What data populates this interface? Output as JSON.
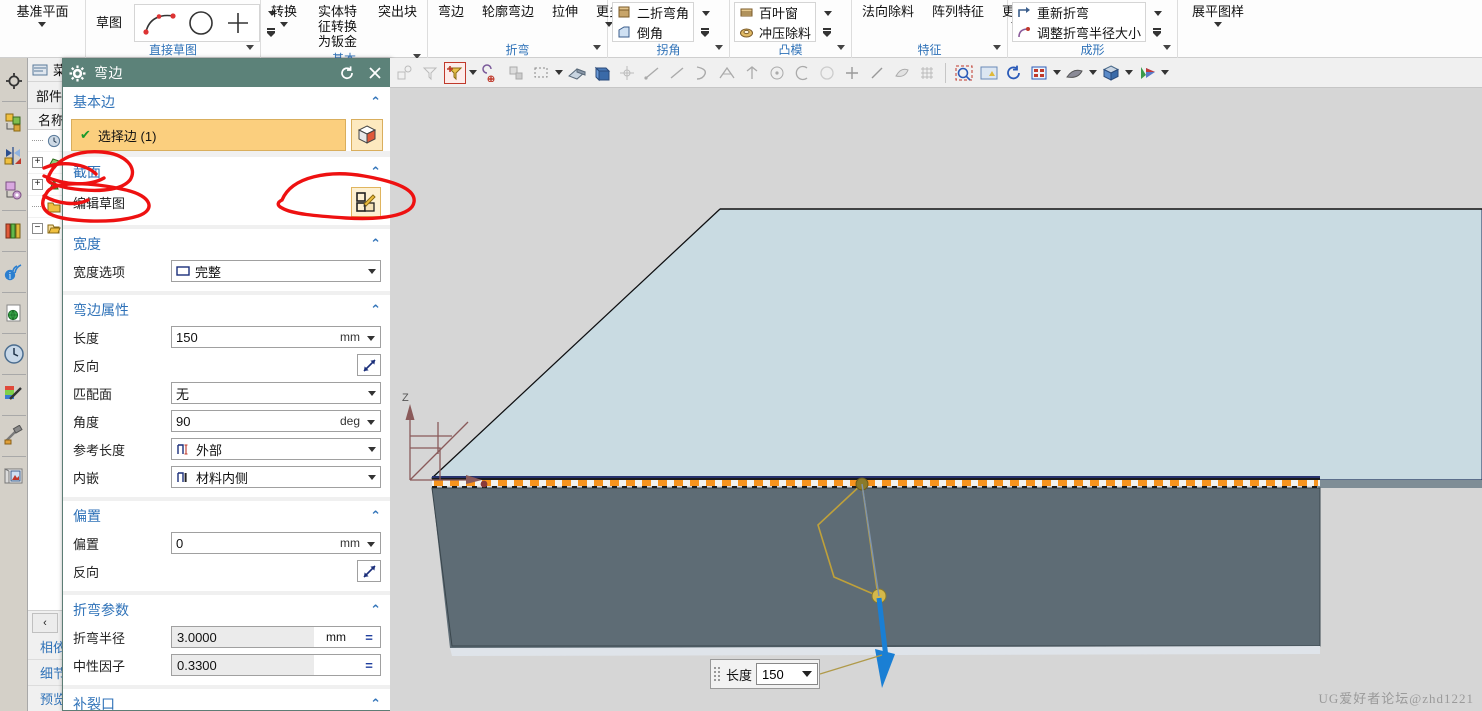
{
  "ribbon": {
    "groups": [
      {
        "title": "",
        "buttons": [
          {
            "label": "基准平面",
            "caret": true
          }
        ]
      },
      {
        "title": "直接草图",
        "buttons": [
          {
            "label": "草图",
            "caret": false
          }
        ],
        "icons": [
          "spline-icon",
          "circle-icon",
          "plus-icon"
        ]
      },
      {
        "title": "基本",
        "buttons": [
          {
            "label": "转换",
            "caret": true
          },
          {
            "label": "实体特征转换为钣金",
            "caret": false
          },
          {
            "label": "突出块",
            "caret": false
          }
        ]
      },
      {
        "title": "折弯",
        "buttons": [
          {
            "label": "弯边",
            "caret": false
          },
          {
            "label": "轮廓弯边",
            "caret": false
          },
          {
            "label": "拉伸",
            "caret": false
          },
          {
            "label": "更多",
            "caret": true
          }
        ]
      },
      {
        "title": "拐角",
        "items": [
          {
            "label": "二折弯角",
            "icon": "bend-corner-icon"
          },
          {
            "label": "倒角",
            "icon": "chamfer-icon"
          }
        ]
      },
      {
        "title": "凸模",
        "items": [
          {
            "label": "百叶窗",
            "icon": "louver-icon"
          },
          {
            "label": "冲压除料",
            "icon": "punch-icon"
          }
        ]
      },
      {
        "title": "特征",
        "buttons": [
          {
            "label": "法向除料",
            "caret": false
          },
          {
            "label": "阵列特征",
            "caret": false
          },
          {
            "label": "更多",
            "caret": true
          }
        ]
      },
      {
        "title": "成形",
        "items": [
          {
            "label": "重新折弯",
            "icon": "rebend-icon"
          },
          {
            "label": "调整折弯半径大小",
            "icon": "resize-bend-icon"
          }
        ]
      },
      {
        "title": "",
        "buttons": [
          {
            "label": "展平图样",
            "caret": true
          }
        ]
      }
    ]
  },
  "menubar": {
    "label": "菜单(M)",
    "icon": "menu-icon"
  },
  "navigator": {
    "panel_title": "部件",
    "column_header": "名称",
    "tree_rows": [
      {
        "expander": "",
        "icon": "history-icon",
        "label": ""
      },
      {
        "expander": "+",
        "icon": "datum-icon",
        "label": ""
      },
      {
        "expander": "+",
        "icon": "model-icon",
        "label": ""
      },
      {
        "expander": "",
        "icon": "folder-icon",
        "label": ""
      },
      {
        "expander": "-",
        "icon": "open-folder-icon",
        "label": ""
      }
    ],
    "collapse_button": "‹",
    "bottom_tabs": [
      "相依",
      "细节",
      "预览"
    ]
  },
  "dialog": {
    "title": "弯边",
    "title_icon": "gear-icon",
    "reset_icon": "reset-icon",
    "close_icon": "close-icon",
    "sections": [
      {
        "id": "base_edge",
        "header": "基本边",
        "select_label": "选择边 (1)",
        "select_check": "✔",
        "select_button_icon": "cube-select-icon"
      },
      {
        "id": "section",
        "header": "截面",
        "link_label": "编辑草图",
        "sketch_button_icon": "edit-sketch-icon"
      },
      {
        "id": "width",
        "header": "宽度",
        "rows": [
          {
            "label": "宽度选项",
            "type": "select",
            "value": "完整",
            "icon": "rect-full-icon"
          }
        ]
      },
      {
        "id": "flange_props",
        "header": "弯边属性",
        "rows": [
          {
            "label": "长度",
            "type": "value_select",
            "value": "150",
            "unit": "mm"
          },
          {
            "label": "反向",
            "type": "reverse",
            "icon": "reverse-direction-icon"
          },
          {
            "label": "匹配面",
            "type": "select",
            "value": "无"
          },
          {
            "label": "角度",
            "type": "value_select",
            "value": "90",
            "unit": "deg"
          },
          {
            "label": "参考长度",
            "type": "select",
            "value": "外部",
            "icon": "ref-length-outer-icon"
          },
          {
            "label": "内嵌",
            "type": "select",
            "value": "材料内侧",
            "icon": "inset-material-inside-icon"
          }
        ]
      },
      {
        "id": "offset",
        "header": "偏置",
        "rows": [
          {
            "label": "偏置",
            "type": "value_select",
            "value": "0",
            "unit": "mm"
          },
          {
            "label": "反向",
            "type": "reverse",
            "icon": "reverse-direction-icon"
          }
        ]
      },
      {
        "id": "bend_params",
        "header": "折弯参数",
        "rows": [
          {
            "label": "折弯半径",
            "type": "expr",
            "value": "3.0000",
            "unit": "mm",
            "eq": "="
          },
          {
            "label": "中性因子",
            "type": "expr",
            "value": "0.3300",
            "unit": "",
            "eq": "="
          }
        ]
      },
      {
        "id": "relief",
        "header": "补裂口"
      }
    ]
  },
  "viewport": {
    "toolbar_icons": [
      "snap-point-icon",
      "filter-icon",
      "selection-filter-icon",
      "snap-to-icon",
      "select-face-icon",
      "rectangle-select-icon",
      "shaded-icon",
      "shaded-edges-icon",
      "move-object-icon",
      "line-icon",
      "line2-icon",
      "spline-icon",
      "arc-icon",
      "point-set-icon",
      "circle-center-icon",
      "arc-icon2",
      "circle-icon",
      "plus-icon",
      "line3-icon",
      "surface-icon",
      "grid-icon",
      "fit-view-icon",
      "pan-icon",
      "rotate-icon",
      "layout-icon",
      "shading-icon",
      "orient-view-icon",
      "style-icon"
    ],
    "length_tag": {
      "label": "长度",
      "value": "150"
    },
    "watermark": "UG爱好者论坛@zhd1221",
    "axis_label": "Z"
  }
}
